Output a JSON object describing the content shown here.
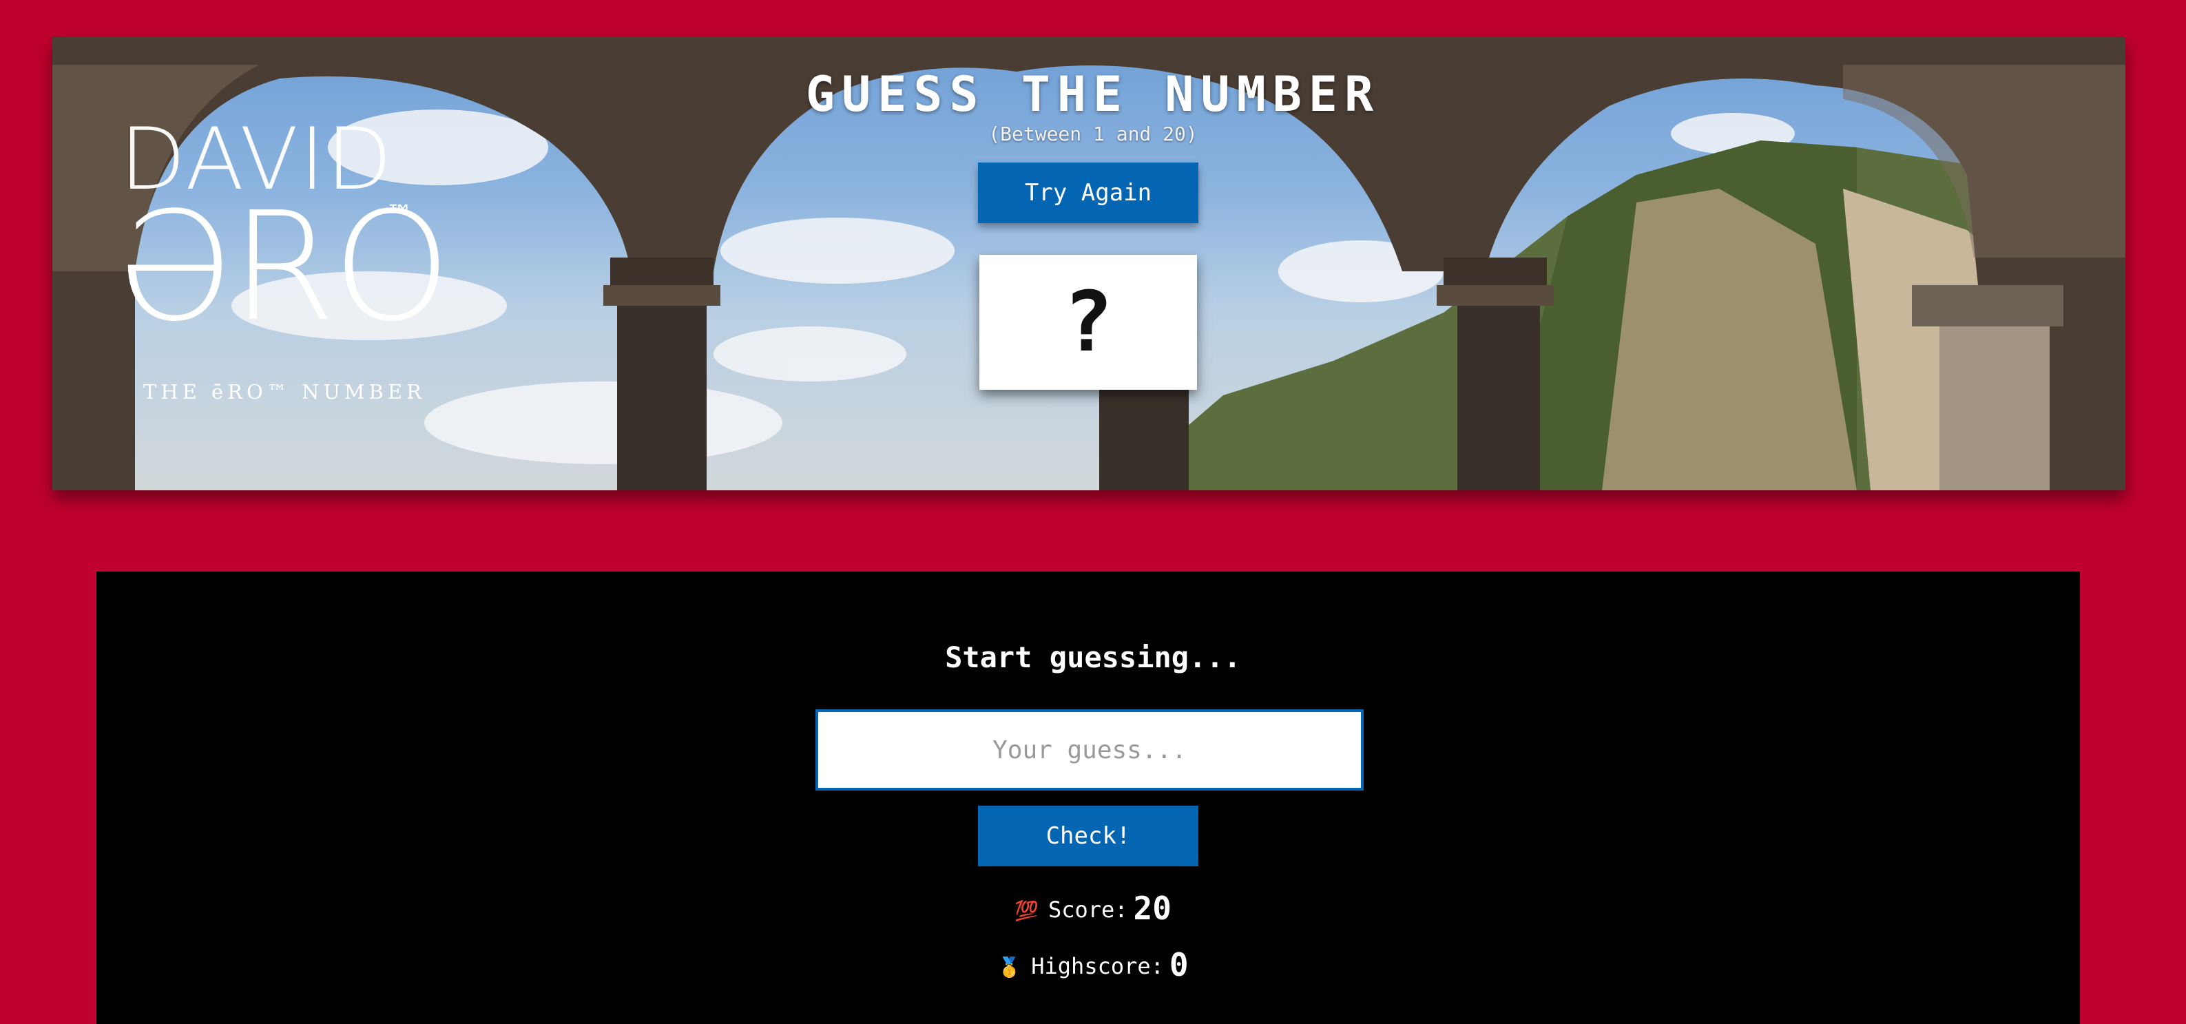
{
  "logo": {
    "line1": "DAVID",
    "line2": "ƏRO",
    "tm": "™",
    "tagline": "THE ēRO™ NUMBER"
  },
  "header": {
    "title": "GUESS THE NUMBER",
    "subtitle": "(Between 1 and 20)",
    "again_label": "Try Again",
    "secret_number": "?"
  },
  "game": {
    "message": "Start guessing...",
    "guess_placeholder": "Your guess...",
    "guess_value": "",
    "check_label": "Check!",
    "score_icon": "💯",
    "score_label": "Score:",
    "score_value": "20",
    "highscore_icon": "🥇",
    "highscore_label": "Highscore:",
    "highscore_value": "0"
  },
  "colors": {
    "background": "#c0002e",
    "panel": "#000000",
    "button": "#0466b2",
    "text": "#ffffff"
  }
}
